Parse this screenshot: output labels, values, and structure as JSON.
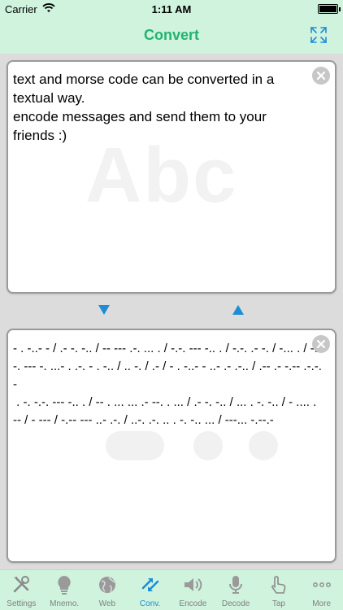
{
  "status": {
    "carrier": "Carrier",
    "time": "1:11 AM"
  },
  "nav": {
    "title": "Convert"
  },
  "input_panel": {
    "watermark": "Abc",
    "text": "text and morse code can be converted in a textual way.\nencode messages and send them to your friends :)"
  },
  "output_panel": {
    "text": "- . -..- - / .- -. -.. / -- --- .-. ... . / -.-. --- -.. . / -.-. .- -. / -... . / -.-. --- -. ...- . .-. - . -.. / .. -. / .- / - . -..- - ..- .- .-.. / .-- .- -.-- .-.-.-\n . -. -.-. --- -.. . / -- . ... ... .- --. . ... / .- -. -.. / ... . -. -.. / - .... . -- / - --- / -.-- --- ..- .-. / ..-. .-. .. . -. -.. ... / ---... -.--.-"
  },
  "tabs": [
    {
      "label": "Settings",
      "icon": "tools-icon"
    },
    {
      "label": "Mnemo.",
      "icon": "lightbulb-icon"
    },
    {
      "label": "Web",
      "icon": "globe-icon"
    },
    {
      "label": "Conv.",
      "icon": "convert-icon"
    },
    {
      "label": "Encode",
      "icon": "speaker-icon"
    },
    {
      "label": "Decode",
      "icon": "microphone-icon"
    },
    {
      "label": "Tap",
      "icon": "hand-tap-icon"
    },
    {
      "label": "More",
      "icon": "more-icon"
    }
  ],
  "active_tab": "Conv.",
  "colors": {
    "bar_background": "#cff3dd",
    "title_green": "#22b371",
    "accent_blue": "#1a8ed6",
    "inactive_gray": "#808080"
  }
}
